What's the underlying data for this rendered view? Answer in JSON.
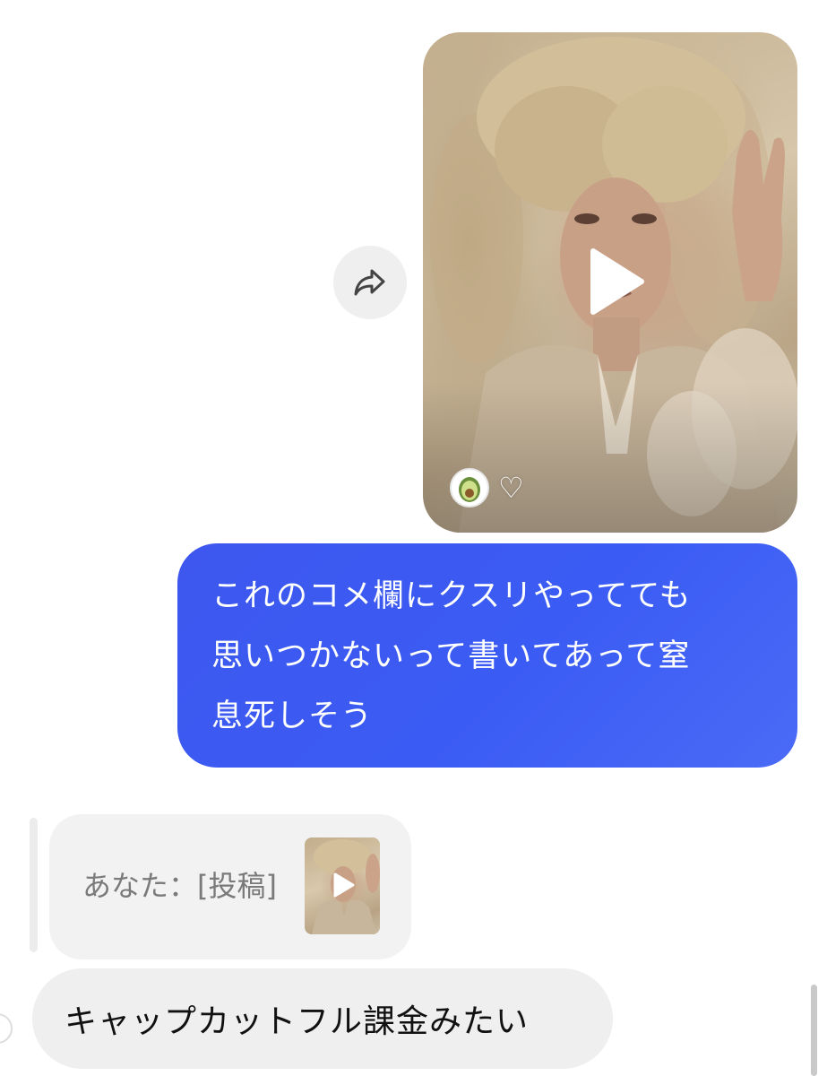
{
  "shared_post": {
    "forward_icon": "share-arrow-icon",
    "play_icon": "play-icon",
    "avatar_icon": "avocado-icon",
    "heart_icon": "♡",
    "tint": "#c9b694"
  },
  "messages": {
    "outgoing": {
      "lines": [
        "これのコメ欄にクスリやってても",
        "思いつかないって書いてあって窒",
        "息死しそう"
      ],
      "color": "#3d5af1"
    },
    "reply_quote": {
      "text": "あなた：[投稿]"
    },
    "incoming": {
      "text": "キャップカットフル課金みたい"
    }
  }
}
